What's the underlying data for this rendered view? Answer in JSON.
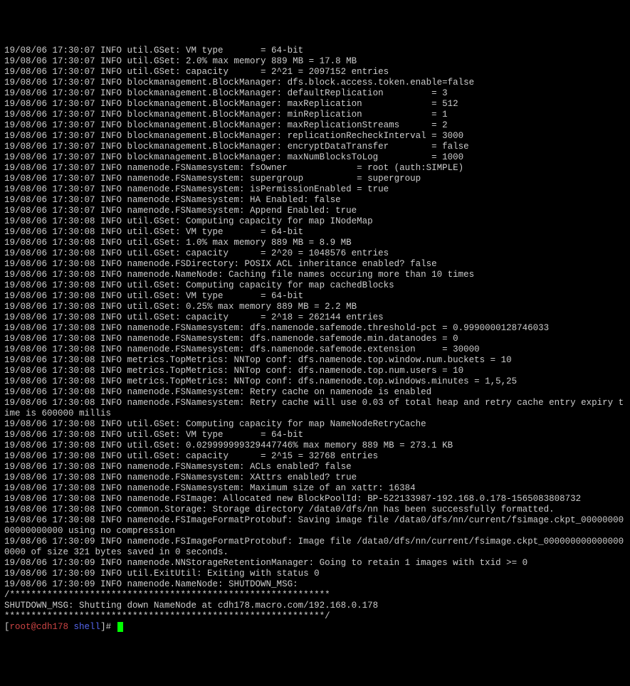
{
  "lines": [
    "19/08/06 17:30:07 INFO util.GSet: VM type       = 64-bit",
    "19/08/06 17:30:07 INFO util.GSet: 2.0% max memory 889 MB = 17.8 MB",
    "19/08/06 17:30:07 INFO util.GSet: capacity      = 2^21 = 2097152 entries",
    "19/08/06 17:30:07 INFO blockmanagement.BlockManager: dfs.block.access.token.enable=false",
    "19/08/06 17:30:07 INFO blockmanagement.BlockManager: defaultReplication         = 3",
    "19/08/06 17:30:07 INFO blockmanagement.BlockManager: maxReplication             = 512",
    "19/08/06 17:30:07 INFO blockmanagement.BlockManager: minReplication             = 1",
    "19/08/06 17:30:07 INFO blockmanagement.BlockManager: maxReplicationStreams      = 2",
    "19/08/06 17:30:07 INFO blockmanagement.BlockManager: replicationRecheckInterval = 3000",
    "19/08/06 17:30:07 INFO blockmanagement.BlockManager: encryptDataTransfer        = false",
    "19/08/06 17:30:07 INFO blockmanagement.BlockManager: maxNumBlocksToLog          = 1000",
    "19/08/06 17:30:07 INFO namenode.FSNamesystem: fsOwner             = root (auth:SIMPLE)",
    "19/08/06 17:30:07 INFO namenode.FSNamesystem: supergroup          = supergroup",
    "19/08/06 17:30:07 INFO namenode.FSNamesystem: isPermissionEnabled = true",
    "19/08/06 17:30:07 INFO namenode.FSNamesystem: HA Enabled: false",
    "19/08/06 17:30:07 INFO namenode.FSNamesystem: Append Enabled: true",
    "19/08/06 17:30:08 INFO util.GSet: Computing capacity for map INodeMap",
    "19/08/06 17:30:08 INFO util.GSet: VM type       = 64-bit",
    "19/08/06 17:30:08 INFO util.GSet: 1.0% max memory 889 MB = 8.9 MB",
    "19/08/06 17:30:08 INFO util.GSet: capacity      = 2^20 = 1048576 entries",
    "19/08/06 17:30:08 INFO namenode.FSDirectory: POSIX ACL inheritance enabled? false",
    "19/08/06 17:30:08 INFO namenode.NameNode: Caching file names occuring more than 10 times",
    "19/08/06 17:30:08 INFO util.GSet: Computing capacity for map cachedBlocks",
    "19/08/06 17:30:08 INFO util.GSet: VM type       = 64-bit",
    "19/08/06 17:30:08 INFO util.GSet: 0.25% max memory 889 MB = 2.2 MB",
    "19/08/06 17:30:08 INFO util.GSet: capacity      = 2^18 = 262144 entries",
    "19/08/06 17:30:08 INFO namenode.FSNamesystem: dfs.namenode.safemode.threshold-pct = 0.9990000128746033",
    "19/08/06 17:30:08 INFO namenode.FSNamesystem: dfs.namenode.safemode.min.datanodes = 0",
    "19/08/06 17:30:08 INFO namenode.FSNamesystem: dfs.namenode.safemode.extension     = 30000",
    "19/08/06 17:30:08 INFO metrics.TopMetrics: NNTop conf: dfs.namenode.top.window.num.buckets = 10",
    "19/08/06 17:30:08 INFO metrics.TopMetrics: NNTop conf: dfs.namenode.top.num.users = 10",
    "19/08/06 17:30:08 INFO metrics.TopMetrics: NNTop conf: dfs.namenode.top.windows.minutes = 1,5,25",
    "19/08/06 17:30:08 INFO namenode.FSNamesystem: Retry cache on namenode is enabled",
    "19/08/06 17:30:08 INFO namenode.FSNamesystem: Retry cache will use 0.03 of total heap and retry cache entry expiry time is 600000 millis",
    "19/08/06 17:30:08 INFO util.GSet: Computing capacity for map NameNodeRetryCache",
    "19/08/06 17:30:08 INFO util.GSet: VM type       = 64-bit",
    "19/08/06 17:30:08 INFO util.GSet: 0.029999999329447746% max memory 889 MB = 273.1 KB",
    "19/08/06 17:30:08 INFO util.GSet: capacity      = 2^15 = 32768 entries",
    "19/08/06 17:30:08 INFO namenode.FSNamesystem: ACLs enabled? false",
    "19/08/06 17:30:08 INFO namenode.FSNamesystem: XAttrs enabled? true",
    "19/08/06 17:30:08 INFO namenode.FSNamesystem: Maximum size of an xattr: 16384",
    "19/08/06 17:30:08 INFO namenode.FSImage: Allocated new BlockPoolId: BP-522133987-192.168.0.178-1565083808732",
    "19/08/06 17:30:08 INFO common.Storage: Storage directory /data0/dfs/nn has been successfully formatted.",
    "19/08/06 17:30:08 INFO namenode.FSImageFormatProtobuf: Saving image file /data0/dfs/nn/current/fsimage.ckpt_0000000000000000000 using no compression",
    "19/08/06 17:30:09 INFO namenode.FSImageFormatProtobuf: Image file /data0/dfs/nn/current/fsimage.ckpt_0000000000000000000 of size 321 bytes saved in 0 seconds.",
    "19/08/06 17:30:09 INFO namenode.NNStorageRetentionManager: Going to retain 1 images with txid >= 0",
    "19/08/06 17:30:09 INFO util.ExitUtil: Exiting with status 0",
    "19/08/06 17:30:09 INFO namenode.NameNode: SHUTDOWN_MSG:",
    "/************************************************************",
    "SHUTDOWN_MSG: Shutting down NameNode at cdh178.macro.com/192.168.0.178",
    "************************************************************/"
  ],
  "prompt": {
    "open": "[",
    "user_host": "root@cdh178",
    "sep": " ",
    "path": "shell",
    "close": "]# "
  }
}
